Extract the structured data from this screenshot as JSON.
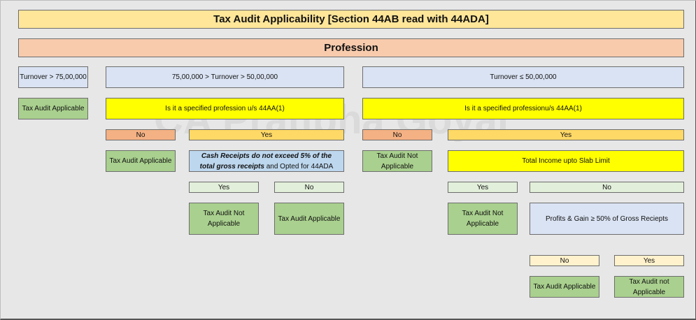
{
  "title": "Tax Audit Applicability [Section 44AB read with 44ADA]",
  "section": "Profession",
  "watermark": "CA Pratibha Goyal",
  "turnover_high": "Turnover > 75,00,000",
  "ta_applicable_1": "Tax Audit Applicable",
  "mid_range": "75,00,000 > Turnover > 50,00,000",
  "low_range": "Turnover ≤ 50,00,000",
  "specified_q_mid": "Is it a specified profession u/s 44AA(1)",
  "specified_q_low": "Is it a specified professionu/s 44AA(1)",
  "mid_no": "No",
  "mid_yes": "Yes",
  "low_no": "No",
  "low_yes": "Yes",
  "mid_no_result": "Tax Audit Applicable",
  "cash_q_part1": "Cash Receipts do not exceed 5% of the total gross receipts",
  "cash_q_part2": " and Opted for 44ADA",
  "low_no_result": "Tax Audit Not Applicable",
  "total_income_q": "Total Income upto Slab Limit",
  "cash_yes": "Yes",
  "cash_no": "No",
  "income_yes": "Yes",
  "income_no": "No",
  "cash_yes_result": "Tax Audit Not Applicable",
  "cash_no_result": "Tax Audit Applicable",
  "income_yes_result": "Tax Audit Not Applicable",
  "profit_q": "Profits & Gain ≥ 50% of Gross Reciepts",
  "profit_no": "No",
  "profit_yes": "Yes",
  "profit_no_result": "Tax Audit Applicable",
  "profit_yes_result": "Tax Audit not Applicable"
}
